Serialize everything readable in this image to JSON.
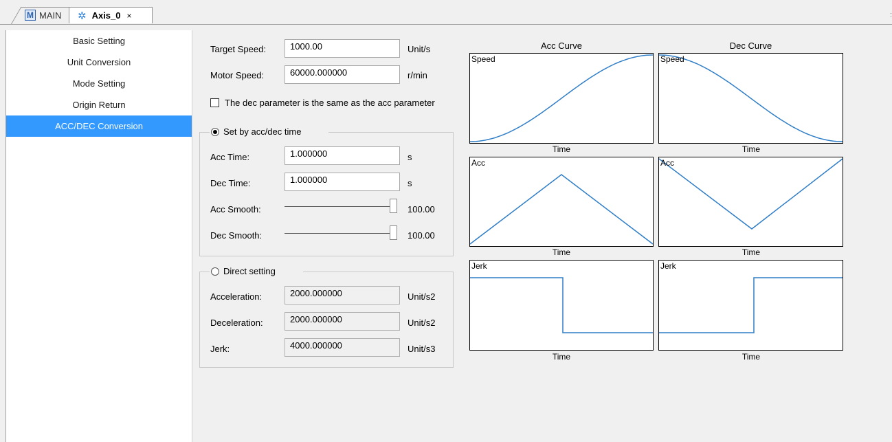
{
  "tabs": {
    "main_label": "MAIN",
    "axis_label": "Axis_0",
    "close_glyph": "×",
    "scroll_glyph": ":"
  },
  "sidebar": {
    "items": [
      {
        "label": "Basic Setting"
      },
      {
        "label": "Unit Conversion"
      },
      {
        "label": "Mode Setting"
      },
      {
        "label": "Origin Return"
      },
      {
        "label": "ACC/DEC Conversion",
        "active": true
      }
    ]
  },
  "params": {
    "target_speed": {
      "label": "Target Speed:",
      "value": "1000.00",
      "unit": "Unit/s"
    },
    "motor_speed": {
      "label": "Motor Speed:",
      "value": "60000.000000",
      "unit": "r/min"
    },
    "same_dec_label": "The dec parameter is the same as the acc parameter",
    "same_dec_checked": false
  },
  "time_group": {
    "title": "Set by acc/dec time",
    "selected": true,
    "acc_time": {
      "label": "Acc Time:",
      "value": "1.000000",
      "unit": "s"
    },
    "dec_time": {
      "label": "Dec Time:",
      "value": "1.000000",
      "unit": "s"
    },
    "acc_smooth": {
      "label": "Acc Smooth:",
      "value": "100.00"
    },
    "dec_smooth": {
      "label": "Dec Smooth:",
      "value": "100.00"
    }
  },
  "direct_group": {
    "title": "Direct setting",
    "selected": false,
    "acceleration": {
      "label": "Acceleration:",
      "value": "2000.000000",
      "unit": "Unit/s2"
    },
    "deceleration": {
      "label": "Deceleration:",
      "value": "2000.000000",
      "unit": "Unit/s2"
    },
    "jerk": {
      "label": "Jerk:",
      "value": "4000.000000",
      "unit": "Unit/s3"
    }
  },
  "curves": {
    "acc_title": "Acc Curve",
    "dec_title": "Dec Curve",
    "speed_label": "Speed",
    "acc_label": "Acc",
    "jerk_label": "Jerk",
    "time_label": "Time"
  },
  "colors": {
    "accent": "#3399ff",
    "curve": "#2f7ec7"
  }
}
